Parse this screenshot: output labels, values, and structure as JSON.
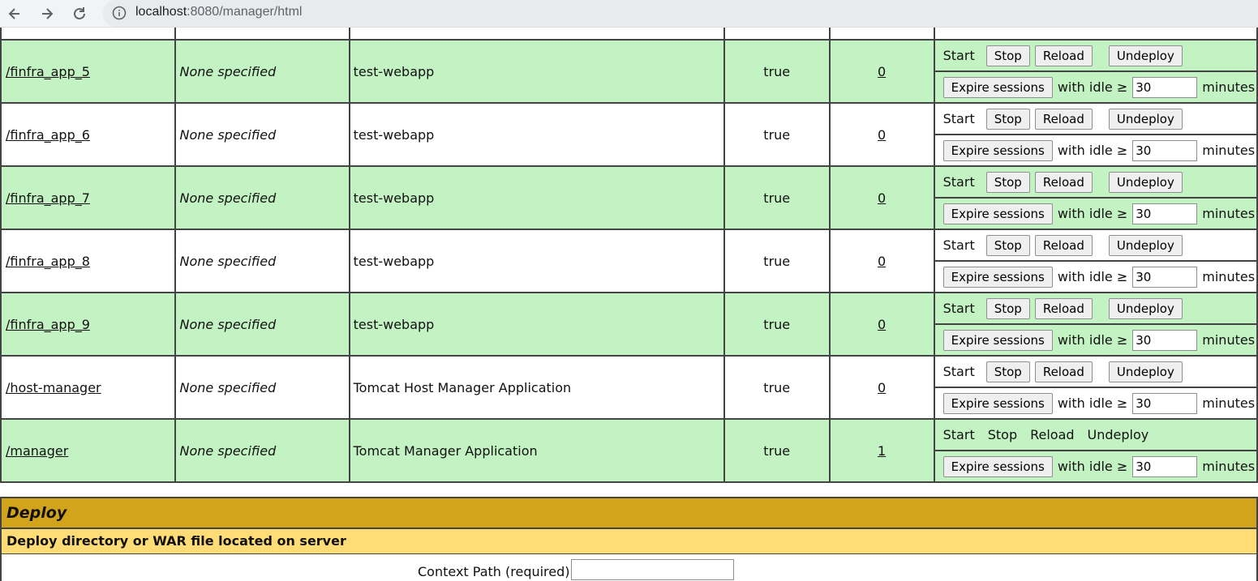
{
  "browser": {
    "url_host": "localhost",
    "url_rest": ":8080/manager/html"
  },
  "apps": [
    {
      "path": "/finfra_app_5",
      "version": "None specified",
      "display_name": "test-webapp",
      "running": "true",
      "sessions": "0",
      "row_color": "green",
      "commands_disabled": false
    },
    {
      "path": "/finfra_app_6",
      "version": "None specified",
      "display_name": "test-webapp",
      "running": "true",
      "sessions": "0",
      "row_color": "white",
      "commands_disabled": false
    },
    {
      "path": "/finfra_app_7",
      "version": "None specified",
      "display_name": "test-webapp",
      "running": "true",
      "sessions": "0",
      "row_color": "green",
      "commands_disabled": false
    },
    {
      "path": "/finfra_app_8",
      "version": "None specified",
      "display_name": "test-webapp",
      "running": "true",
      "sessions": "0",
      "row_color": "white",
      "commands_disabled": false
    },
    {
      "path": "/finfra_app_9",
      "version": "None specified",
      "display_name": "test-webapp",
      "running": "true",
      "sessions": "0",
      "row_color": "green",
      "commands_disabled": false
    },
    {
      "path": "/host-manager",
      "version": "None specified",
      "display_name": "Tomcat Host Manager Application",
      "running": "true",
      "sessions": "0",
      "row_color": "white",
      "commands_disabled": false
    },
    {
      "path": "/manager",
      "version": "None specified",
      "display_name": "Tomcat Manager Application",
      "running": "true",
      "sessions": "1",
      "row_color": "green",
      "commands_disabled": true
    }
  ],
  "commands": {
    "start": "Start",
    "stop": "Stop",
    "reload": "Reload",
    "undeploy": "Undeploy",
    "expire": "Expire sessions",
    "with_idle": "with idle ≥",
    "idle_value": "30",
    "minutes": "minutes"
  },
  "deploy": {
    "title": "Deploy",
    "subtitle": "Deploy directory or WAR file located on server",
    "context_label": "Context Path (required):"
  },
  "colors": {
    "row_green": "#c3f3c3",
    "deploy_header": "#d2a41c",
    "deploy_sub": "#ffdc75"
  }
}
